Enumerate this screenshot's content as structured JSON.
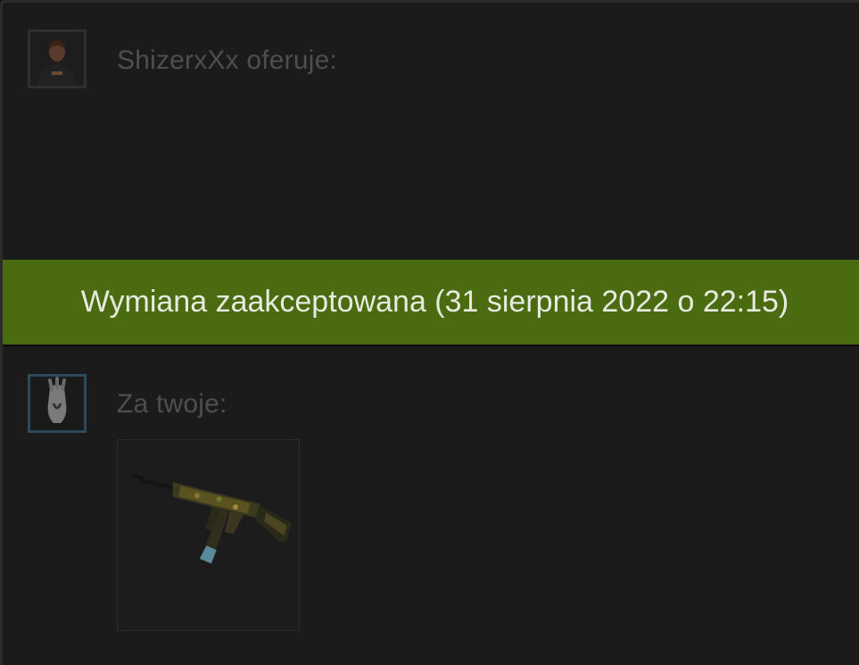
{
  "offer": {
    "partner_label": "ShizerxXx oferuje:",
    "status_text": "Wymiana zaakceptowana (31 sierpnia 2022 o 22:15)",
    "your_label": "Za twoje:"
  },
  "colors": {
    "accepted_banner": "#4a6b10",
    "background": "#1b1b1b",
    "muted_text": "#4e4e4e"
  },
  "icons": {
    "partner_avatar": "person-avatar-icon",
    "your_avatar": "hand-avatar-icon",
    "item": "ak47-rifle-icon"
  }
}
